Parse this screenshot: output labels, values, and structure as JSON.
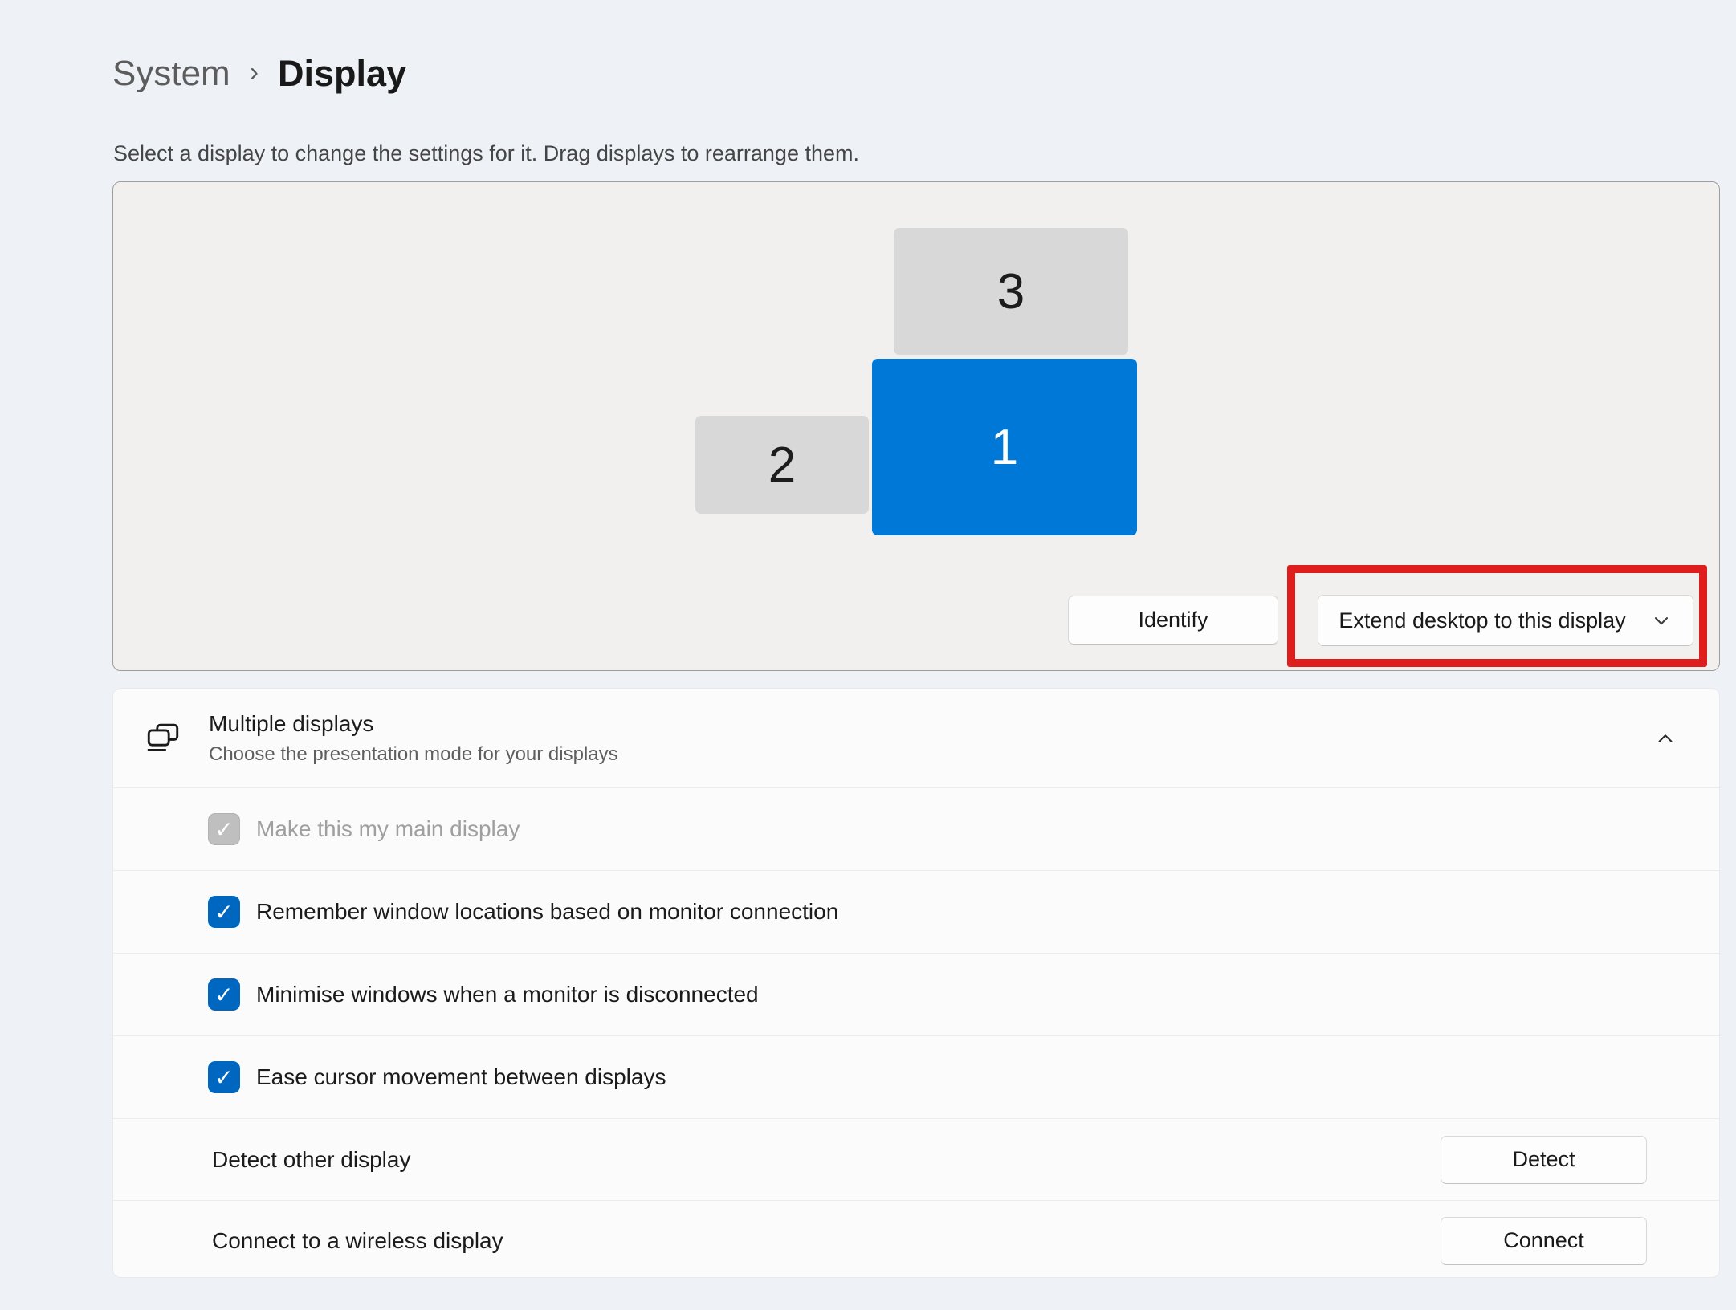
{
  "breadcrumb": {
    "parent": "System",
    "separator": "›",
    "current": "Display"
  },
  "intro": "Select a display to change the settings for it. Drag displays to rearrange them.",
  "arrangement": {
    "monitors": [
      {
        "label": "3",
        "selected": false
      },
      {
        "label": "2",
        "selected": false
      },
      {
        "label": "1",
        "selected": true
      }
    ],
    "identify_button": "Identify",
    "display_mode_dropdown": "Extend desktop to this display"
  },
  "multiple_displays": {
    "title": "Multiple displays",
    "subtitle": "Choose the presentation mode for your displays",
    "checkboxes": [
      {
        "label": "Make this my main display",
        "checked": true,
        "disabled": true
      },
      {
        "label": "Remember window locations based on monitor connection",
        "checked": true,
        "disabled": false
      },
      {
        "label": "Minimise windows when a monitor is disconnected",
        "checked": true,
        "disabled": false
      },
      {
        "label": "Ease cursor movement between displays",
        "checked": true,
        "disabled": false
      }
    ],
    "actions": [
      {
        "label": "Detect other display",
        "button": "Detect"
      },
      {
        "label": "Connect to a wireless display",
        "button": "Connect"
      }
    ]
  },
  "glyphs": {
    "checkmark": "✓"
  },
  "colors": {
    "accent_blue": "#0078d7",
    "checkbox_blue": "#0067c0",
    "annotation_red": "#e01d1d",
    "monitor_gray": "#d8d8d8",
    "page_background": "#eef2f7",
    "panel_background": "#f1f0ef",
    "card_background": "#fbfbfc"
  }
}
